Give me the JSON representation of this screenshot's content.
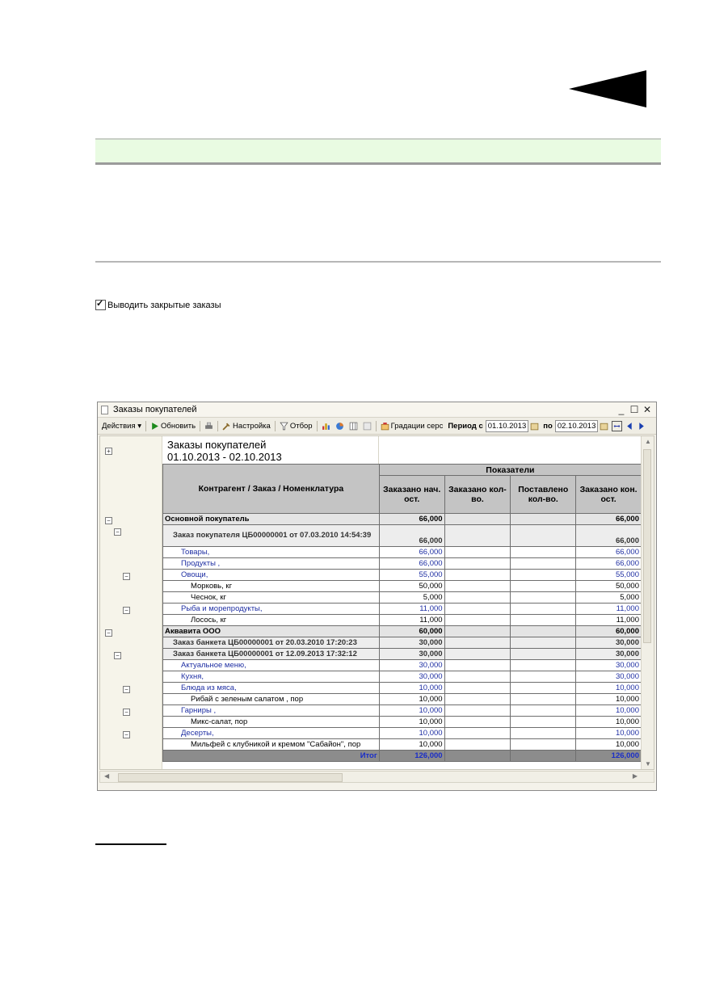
{
  "page": {
    "checkbox_label": "Выводить закрытые заказы",
    "checkbox_checked": true
  },
  "window": {
    "title": "Заказы покупателей",
    "controls": {
      "minimize": "_",
      "maximize": "☐",
      "close": "✕"
    }
  },
  "toolbar": {
    "actions": "Действия ▾",
    "refresh": "Обновить",
    "settings": "Настройка",
    "filter": "Отбор",
    "gradations": "Градации серс",
    "period_from_label": "Период с",
    "date_from": "01.10.2013",
    "period_to_label": "по",
    "date_to": "02.10.2013"
  },
  "report": {
    "title": "Заказы покупателей",
    "period": "01.10.2013 - 02.10.2013",
    "group_header": "Показатели",
    "row_header": "Контрагент / Заказ / Номенклатура",
    "columns": [
      "Заказано нач. ост.",
      "Заказано кол-во.",
      "Поставлено кол-во.",
      "Заказано кон. ост."
    ],
    "rows": [
      {
        "level": 0,
        "label": "Основной покупатель",
        "values": [
          "66,000",
          "",
          "",
          "66,000"
        ]
      },
      {
        "level": 1,
        "label": "Заказ покупателя ЦБ00000001 от 07.03.2010 14:54:39",
        "values": [
          "66,000",
          "",
          "",
          "66,000"
        ],
        "tall": true
      },
      {
        "level": 2,
        "label": "Товары,",
        "values": [
          "66,000",
          "",
          "",
          "66,000"
        ]
      },
      {
        "level": 2,
        "label": "Продукты ,",
        "values": [
          "66,000",
          "",
          "",
          "66,000"
        ]
      },
      {
        "level": 2,
        "label": "Овощи,",
        "values": [
          "55,000",
          "",
          "",
          "55,000"
        ]
      },
      {
        "level": 3,
        "label": "Морковь, кг",
        "values": [
          "50,000",
          "",
          "",
          "50,000"
        ]
      },
      {
        "level": 3,
        "label": "Чеснок, кг",
        "values": [
          "5,000",
          "",
          "",
          "5,000"
        ]
      },
      {
        "level": 2,
        "label": "Рыба и морепродукты,",
        "values": [
          "11,000",
          "",
          "",
          "11,000"
        ]
      },
      {
        "level": 3,
        "label": "Лосось, кг",
        "values": [
          "11,000",
          "",
          "",
          "11,000"
        ]
      },
      {
        "level": 0,
        "label": "Аквавита ООО",
        "values": [
          "60,000",
          "",
          "",
          "60,000"
        ]
      },
      {
        "level": 1,
        "label": "Заказ банкета ЦБ00000001 от 20.03.2010 17:20:23",
        "values": [
          "30,000",
          "",
          "",
          "30,000"
        ]
      },
      {
        "level": 1,
        "label": "Заказ банкета ЦБ00000001 от 12.09.2013 17:32:12",
        "values": [
          "30,000",
          "",
          "",
          "30,000"
        ]
      },
      {
        "level": 2,
        "label": "Актуальное меню,",
        "values": [
          "30,000",
          "",
          "",
          "30,000"
        ]
      },
      {
        "level": 2,
        "label": "Кухня,",
        "values": [
          "30,000",
          "",
          "",
          "30,000"
        ]
      },
      {
        "level": 2,
        "label": "Блюда из мяса,",
        "values": [
          "10,000",
          "",
          "",
          "10,000"
        ]
      },
      {
        "level": 3,
        "label": "Рибай с зеленым салатом , пор",
        "values": [
          "10,000",
          "",
          "",
          "10,000"
        ]
      },
      {
        "level": 2,
        "label": "Гарниры ,",
        "values": [
          "10,000",
          "",
          "",
          "10,000"
        ]
      },
      {
        "level": 3,
        "label": "Микс-салат, пор",
        "values": [
          "10,000",
          "",
          "",
          "10,000"
        ]
      },
      {
        "level": 2,
        "label": "Десерты,",
        "values": [
          "10,000",
          "",
          "",
          "10,000"
        ]
      },
      {
        "level": 3,
        "label": "Мильфей с клубникой и кремом \"Сабайон\", пор",
        "values": [
          "10,000",
          "",
          "",
          "10,000"
        ]
      }
    ],
    "total": {
      "label": "Итог",
      "values": [
        "126,000",
        "",
        "",
        "126,000"
      ]
    }
  },
  "colors": {
    "band": "#e9fbe2",
    "link_blue": "#1f2fa3",
    "header_gray": "#c4c4c4",
    "total_gray": "#8c8c8c"
  }
}
